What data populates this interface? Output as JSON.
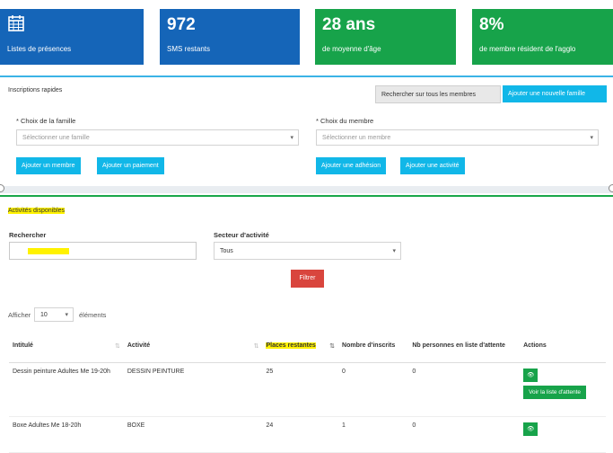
{
  "tiles": [
    {
      "value": "",
      "label": "Listes de présences",
      "color": "#1565b8",
      "icon": "calendar-icon"
    },
    {
      "value": "972",
      "label": "SMS restants",
      "color": "#1565b8"
    },
    {
      "value": "28 ans",
      "label": "de moyenne d'âge",
      "color": "#17a34a"
    },
    {
      "value": "8%",
      "label": "de membre résident de l'agglo",
      "color": "#17a34a"
    }
  ],
  "quick": {
    "title": "Inscriptions rapides",
    "search_all_label": "Rechercher sur tous les membres",
    "add_family_label": "Ajouter une nouvelle famille",
    "family_label": "* Choix de la famille",
    "family_placeholder": "Sélectionner une famille",
    "member_label": "* Choix du membre",
    "member_placeholder": "Sélectionner un membre",
    "add_member_label": "Ajouter un membre",
    "add_payment_label": "Ajouter un paiement",
    "add_membership_label": "Ajouter une adhésion",
    "add_activity_label": "Ajouter une activité"
  },
  "activities": {
    "title": "Activités disponibles",
    "search_label": "Rechercher",
    "sector_label": "Secteur d'activité",
    "sector_value": "Tous",
    "filter_label": "Filtrer",
    "show_label": "Afficher",
    "show_value": "10",
    "elements_label": "éléments",
    "columns": [
      "Intitulé",
      "Activité",
      "Places restantes",
      "Nombre d'inscrits",
      "Nb personnes en liste d'attente",
      "Actions"
    ],
    "rows": [
      {
        "title": "Dessin peinture Adultes Me 19-20h",
        "activity": "DESSIN PEINTURE",
        "places": "25",
        "registered": "0",
        "waiting": "0"
      },
      {
        "title": "Boxe Adultes Me 18-20h",
        "activity": "BOXE",
        "places": "24",
        "registered": "1",
        "waiting": "0"
      }
    ],
    "waitlist_label": "Voir la liste d'attente",
    "view_icon": "eye-icon"
  },
  "colors": {
    "blue": "#1565b8",
    "green": "#17a34a",
    "cyan": "#11b7e8",
    "red": "#d9453d",
    "highlight": "#fff200"
  }
}
